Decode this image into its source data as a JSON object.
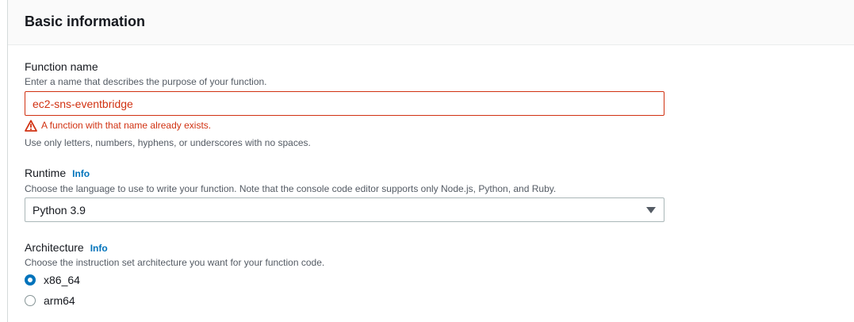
{
  "section": {
    "title": "Basic information"
  },
  "function_name": {
    "label": "Function name",
    "description": "Enter a name that describes the purpose of your function.",
    "value": "ec2-sns-eventbridge",
    "error": "A function with that name already exists.",
    "constraint": "Use only letters, numbers, hyphens, or underscores with no spaces."
  },
  "runtime": {
    "label": "Runtime",
    "info": "Info",
    "description": "Choose the language to use to write your function. Note that the console code editor supports only Node.js, Python, and Ruby.",
    "selected": "Python 3.9"
  },
  "architecture": {
    "label": "Architecture",
    "info": "Info",
    "description": "Choose the instruction set architecture you want for your function code.",
    "options": [
      {
        "label": "x86_64",
        "checked": true
      },
      {
        "label": "arm64",
        "checked": false
      }
    ]
  },
  "colors": {
    "error": "#d13212",
    "link": "#0073bb",
    "header_bg": "#fafafa"
  }
}
